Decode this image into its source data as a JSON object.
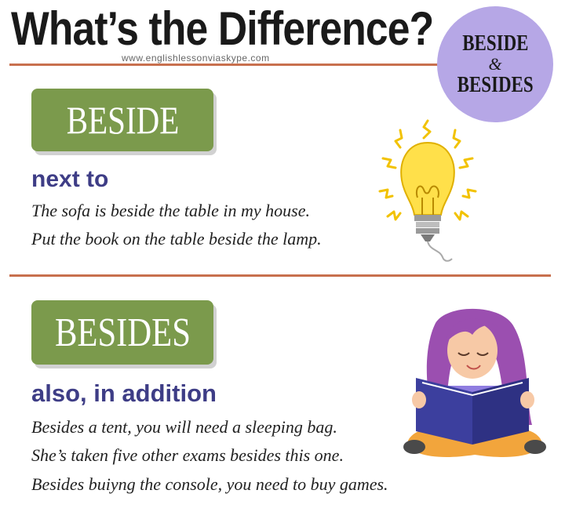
{
  "header": {
    "title": "What’s the Difference?",
    "website": "www.englishlessonviaskype.com"
  },
  "badge": {
    "word1": "BESIDE",
    "amp": "&",
    "word2": "BESIDES"
  },
  "sections": [
    {
      "word": "BESIDE",
      "meaning": "next to",
      "examples": [
        "The sofa is beside the table in my house.",
        "Put the book on the table beside the lamp."
      ]
    },
    {
      "word": "BESIDES",
      "meaning": "also, in addition",
      "examples": [
        "Besides a tent, you will need a sleeping bag.",
        "She’s taken five other exams besides this one.",
        "Besides buiyng the console, you need to buy games."
      ]
    }
  ],
  "colors": {
    "tag_green": "#7b9a4c",
    "meaning_purple": "#3e3d86",
    "badge_lavender": "#b6a7e6",
    "rule_orange": "#c8704e"
  },
  "icons": {
    "section1": "lightbulb-icon",
    "section2": "girl-reading-book-illustration"
  }
}
